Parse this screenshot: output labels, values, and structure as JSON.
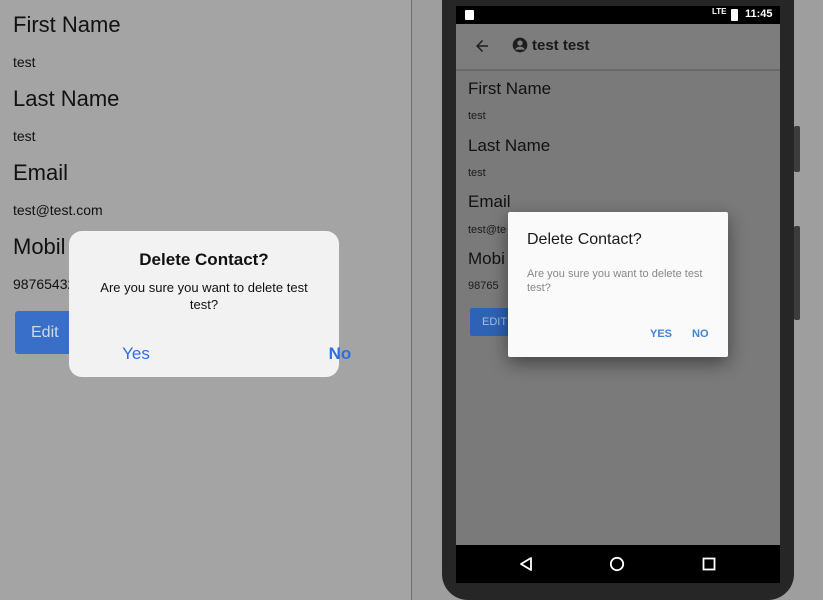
{
  "ios": {
    "fields": [
      {
        "label": "First Name",
        "value": "test"
      },
      {
        "label": "Last Name",
        "value": "test"
      },
      {
        "label": "Email",
        "value": "test@test.com"
      },
      {
        "label": "Mobil",
        "value": "98765432"
      }
    ],
    "edit_label": "Edit",
    "alert": {
      "title": "Delete Contact?",
      "message": "Are you sure you want to delete test test?",
      "yes_label": "Yes",
      "no_label": "No"
    }
  },
  "android": {
    "status_bar": {
      "network": "LTE",
      "time": "11:45"
    },
    "app_bar": {
      "title": "test test",
      "back_icon": "arrow-back-icon",
      "person_icon": "account-circle-icon"
    },
    "fields": [
      {
        "label": "First Name",
        "value": "test"
      },
      {
        "label": "Last Name",
        "value": "test"
      },
      {
        "label": "Email",
        "value": "test@te"
      },
      {
        "label": "Mobi",
        "value": "98765"
      }
    ],
    "edit_label": "EDIT",
    "dialog": {
      "title": "Delete Contact?",
      "message": "Are you sure you want to delete test test?",
      "yes_label": "YES",
      "no_label": "NO"
    },
    "nav_icons": [
      "back-triangle-icon",
      "home-circle-icon",
      "recents-square-icon"
    ]
  },
  "colors": {
    "ios_accent": "#2f6fe0",
    "android_accent": "#3d84d6",
    "button_blue": "#3a6fc9"
  }
}
